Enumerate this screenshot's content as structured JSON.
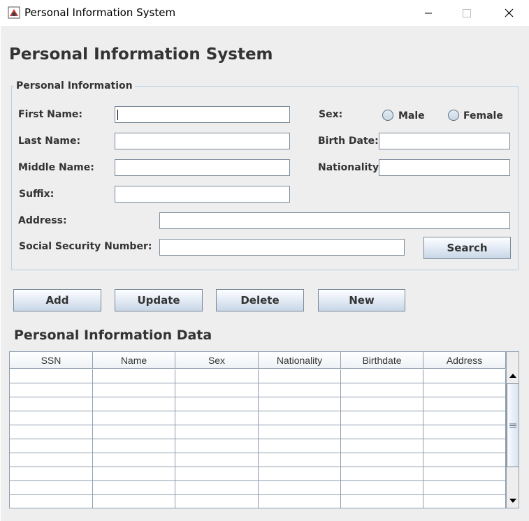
{
  "window": {
    "title": "Personal Information System",
    "app_icon": "java-app-icon",
    "controls": [
      "minimize-icon",
      "maximize-icon",
      "close-icon"
    ]
  },
  "main": {
    "heading": "Personal Information System",
    "group_title": "Personal Information",
    "labels": {
      "first_name": "First Name:",
      "last_name": "Last Name:",
      "middle_name": "Middle Name:",
      "suffix": "Suffix:",
      "address": "Address:",
      "ssn": "Social Security Number:",
      "sex": "Sex:",
      "birth_date": "Birth Date:",
      "nationality": "Nationality:"
    },
    "fields": {
      "first_name": "",
      "last_name": "",
      "middle_name": "",
      "suffix": "",
      "address": "",
      "ssn": "",
      "birth_date": "",
      "nationality": ""
    },
    "sex_options": [
      "Male",
      "Female"
    ],
    "search_button": "Search",
    "actions": {
      "add": "Add",
      "update": "Update",
      "delete": "Delete",
      "new": "New"
    }
  },
  "table": {
    "heading": "Personal Information Data",
    "columns": [
      "SSN",
      "Name",
      "Sex",
      "Nationality",
      "Birthdate",
      "Address"
    ],
    "rows": []
  },
  "colors": {
    "background": "#eeeeee",
    "groupbox_border": "#b8cfe5",
    "text": "#333333",
    "button_gradient_top": "#fdfeff",
    "button_gradient_bottom": "#c8d6e6"
  }
}
